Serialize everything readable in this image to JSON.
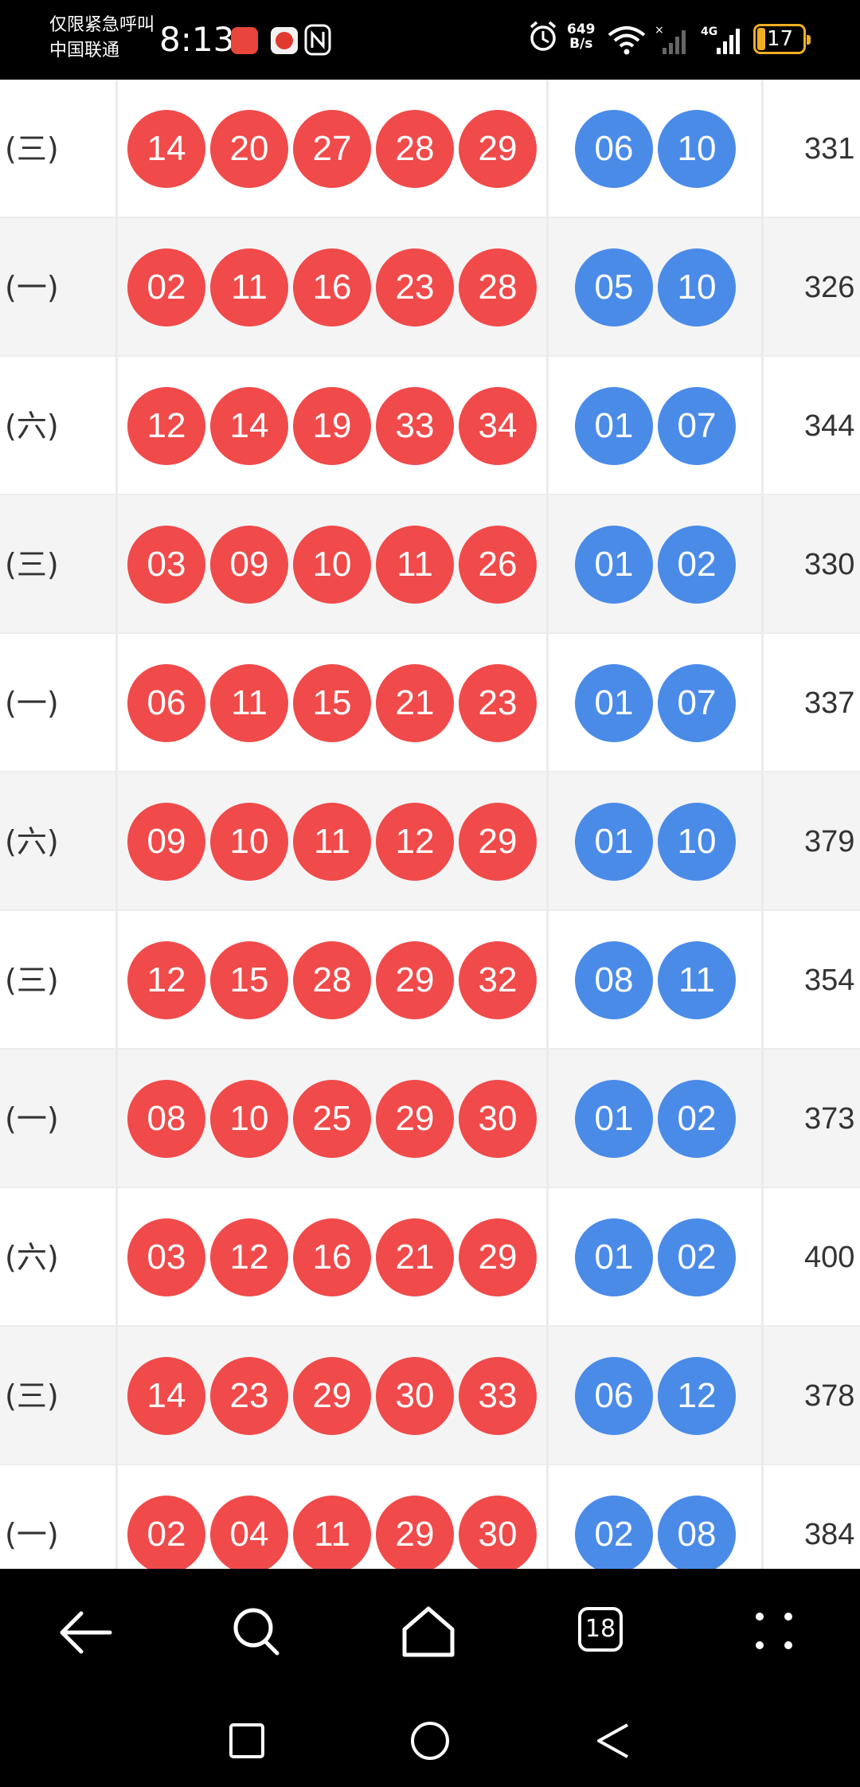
{
  "status_bar": {
    "carrier_line1": "仅限紧急呼叫",
    "carrier_line2": "中国联通",
    "time": "8:13",
    "net_speed_value": "649",
    "net_speed_unit": "B/s",
    "network_type": "4G",
    "battery_level": "17",
    "icons": [
      "huawei-app-icon",
      "game-app-icon",
      "nfc-icon",
      "alarm-icon",
      "wifi-icon",
      "signal-icon",
      "signal-4g-icon",
      "battery-icon"
    ]
  },
  "rows": [
    {
      "weekday": "(三)",
      "red": [
        "14",
        "20",
        "27",
        "28",
        "29"
      ],
      "blue": [
        "06",
        "10"
      ],
      "sum": "331"
    },
    {
      "weekday": "(一)",
      "red": [
        "02",
        "11",
        "16",
        "23",
        "28"
      ],
      "blue": [
        "05",
        "10"
      ],
      "sum": "326"
    },
    {
      "weekday": "(六)",
      "red": [
        "12",
        "14",
        "19",
        "33",
        "34"
      ],
      "blue": [
        "01",
        "07"
      ],
      "sum": "344"
    },
    {
      "weekday": "(三)",
      "red": [
        "03",
        "09",
        "10",
        "11",
        "26"
      ],
      "blue": [
        "01",
        "02"
      ],
      "sum": "330"
    },
    {
      "weekday": "(一)",
      "red": [
        "06",
        "11",
        "15",
        "21",
        "23"
      ],
      "blue": [
        "01",
        "07"
      ],
      "sum": "337"
    },
    {
      "weekday": "(六)",
      "red": [
        "09",
        "10",
        "11",
        "12",
        "29"
      ],
      "blue": [
        "01",
        "10"
      ],
      "sum": "379"
    },
    {
      "weekday": "(三)",
      "red": [
        "12",
        "15",
        "28",
        "29",
        "32"
      ],
      "blue": [
        "08",
        "11"
      ],
      "sum": "354"
    },
    {
      "weekday": "(一)",
      "red": [
        "08",
        "10",
        "25",
        "29",
        "30"
      ],
      "blue": [
        "01",
        "02"
      ],
      "sum": "373"
    },
    {
      "weekday": "(六)",
      "red": [
        "03",
        "12",
        "16",
        "21",
        "29"
      ],
      "blue": [
        "01",
        "02"
      ],
      "sum": "400"
    },
    {
      "weekday": "(三)",
      "red": [
        "14",
        "23",
        "29",
        "30",
        "33"
      ],
      "blue": [
        "06",
        "12"
      ],
      "sum": "378"
    },
    {
      "weekday": "(一)",
      "red": [
        "02",
        "04",
        "11",
        "29",
        "30"
      ],
      "blue": [
        "02",
        "08"
      ],
      "sum": "384"
    }
  ],
  "toolbar": {
    "tab_count": "18",
    "icons": [
      "back-icon",
      "search-icon",
      "home-icon",
      "tabs-icon",
      "more-icon"
    ]
  },
  "colors": {
    "red_ball": "#f04a4a",
    "blue_ball": "#4a8be8",
    "battery": "#f0b020",
    "row_alt": "#f4f4f4"
  }
}
